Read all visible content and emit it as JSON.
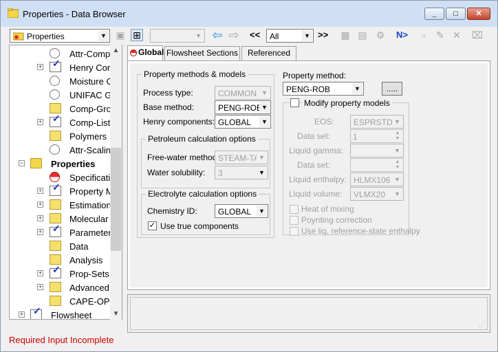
{
  "window": {
    "title": "Properties - Data Browser"
  },
  "toolbar": {
    "form_select": "Properties",
    "nav_prev": "<<",
    "nav_next": ">>",
    "filter_select": "All",
    "next_label": "N>"
  },
  "tree": {
    "items": [
      {
        "label": "Attr-Comp",
        "icon": "circle-icon"
      },
      {
        "label": "Henry Con",
        "icon": "folder-check-icon"
      },
      {
        "label": "Moisture C",
        "icon": "circle-icon"
      },
      {
        "label": "UNIFAC Gr",
        "icon": "circle-icon"
      },
      {
        "label": "Comp-Gro",
        "icon": "folder-icon"
      },
      {
        "label": "Comp-List",
        "icon": "folder-check-icon"
      },
      {
        "label": "Polymers",
        "icon": "folder-icon"
      },
      {
        "label": "Attr-Scalin",
        "icon": "circle-icon"
      },
      {
        "label": "Properties",
        "icon": "open-folder-icon"
      },
      {
        "label": "Specificati",
        "icon": "red-circle-icon"
      },
      {
        "label": "Property M",
        "icon": "folder-check-icon"
      },
      {
        "label": "Estimation",
        "icon": "folder-icon"
      },
      {
        "label": "Molecular",
        "icon": "folder-icon"
      },
      {
        "label": "Parameter",
        "icon": "folder-check-icon"
      },
      {
        "label": "Data",
        "icon": "folder-icon"
      },
      {
        "label": "Analysis",
        "icon": "folder-icon"
      },
      {
        "label": "Prop-Sets",
        "icon": "folder-check-icon"
      },
      {
        "label": "Advanced",
        "icon": "folder-icon"
      },
      {
        "label": "CAPE-OPE",
        "icon": "folder-icon"
      },
      {
        "label": "Flowsheet",
        "icon": "folder-check-icon"
      }
    ]
  },
  "status": {
    "text": "Required Input Incomplete"
  },
  "tabs": [
    {
      "label": "Global"
    },
    {
      "label": "Flowsheet Sections"
    },
    {
      "label": "Referenced"
    }
  ],
  "global": {
    "methods_group": "Property methods & models",
    "process_type_label": "Process type:",
    "process_type_value": "COMMON",
    "base_method_label": "Base method:",
    "base_method_value": "PENG-ROB",
    "henry_label": "Henry components:",
    "henry_value": "GLOBAL",
    "petro_group": "Petroleum calculation options",
    "free_water_label": "Free-water method:",
    "free_water_value": "STEAM-TA",
    "water_sol_label": "Water solubility:",
    "water_sol_value": "3",
    "electrolyte_group": "Electrolyte calculation options",
    "chem_id_label": "Chemistry ID:",
    "chem_id_value": "GLOBAL",
    "true_comp_label": "Use true components",
    "prop_method_label": "Property method:",
    "prop_method_value": "PENG-ROB",
    "ellipsis": ".....",
    "modify_label": "Modify property models",
    "eos_label": "EOS:",
    "eos_value": "ESPRSTD",
    "dataset_label": "Data set:",
    "dataset_value": "1",
    "liq_gamma_label": "Liquid gamma:",
    "dataset2_label": "Data set:",
    "liq_enth_label": "Liquid enthalpy:",
    "liq_enth_value": "HLMX106",
    "liq_vol_label": "Liquid volume:",
    "liq_vol_value": "VLMX20",
    "heat_mix_label": "Heat of mixing",
    "poynting_label": "Poynting correction",
    "liq_ref_label": "Use liq. reference-state enthalpy"
  }
}
